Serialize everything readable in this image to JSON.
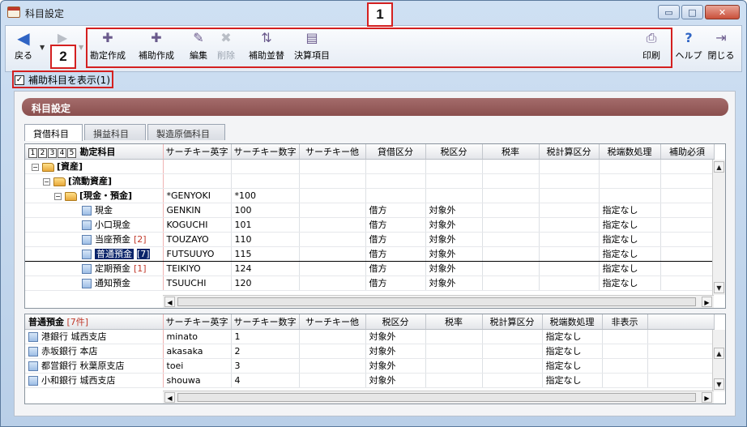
{
  "window": {
    "title": "科目設定",
    "buttons": {
      "minimize": "▭",
      "maximize": "□",
      "close": "✕"
    }
  },
  "toolbar": {
    "back": "戻る",
    "buttons": [
      {
        "id": "kanjo-sakusei",
        "label": "勘定作成",
        "icon": "add-account-icon",
        "disabled": false
      },
      {
        "id": "hojo-sakusei",
        "label": "補助作成",
        "icon": "add-sub-account-icon",
        "disabled": false
      },
      {
        "id": "henshu",
        "label": "編集",
        "icon": "edit-icon",
        "disabled": false
      },
      {
        "id": "sakujo",
        "label": "削除",
        "icon": "delete-icon",
        "disabled": true
      },
      {
        "id": "hojo-narabikae",
        "label": "補助並替",
        "icon": "reorder-icon",
        "disabled": false
      },
      {
        "id": "kessan-komoku",
        "label": "決算項目",
        "icon": "settlement-icon",
        "disabled": false
      },
      {
        "id": "insatsu",
        "label": "印刷",
        "icon": "print-icon",
        "disabled": false
      },
      {
        "id": "help",
        "label": "ヘルプ",
        "icon": "help-icon",
        "disabled": false
      },
      {
        "id": "tojiru",
        "label": "閉じる",
        "icon": "close-door-icon",
        "disabled": false
      }
    ]
  },
  "callouts": {
    "one": "1",
    "two": "2"
  },
  "show_sub": {
    "label": "補助科目を表示(1)",
    "checked": true
  },
  "panel": {
    "title": "科目設定"
  },
  "tabs": [
    {
      "label": "貸借科目",
      "active": true
    },
    {
      "label": "損益科目",
      "active": false
    },
    {
      "label": "製造原価科目",
      "active": false
    }
  ],
  "upper_grid": {
    "levels": [
      "1",
      "2",
      "3",
      "4",
      "5"
    ],
    "tree_header": "勘定科目",
    "columns": [
      "サーチキー英字",
      "サーチキー数字",
      "サーチキー他",
      "貸借区分",
      "税区分",
      "税率",
      "税計算区分",
      "税端数処理",
      "補助必須"
    ],
    "rows": [
      {
        "depth": 0,
        "type": "folder",
        "expand": "−",
        "name": "[資産]",
        "bold": true,
        "count": "",
        "cells": [
          "",
          "",
          "",
          "",
          "",
          "",
          "",
          "",
          ""
        ]
      },
      {
        "depth": 1,
        "type": "folder",
        "expand": "−",
        "name": "[流動資産]",
        "bold": true,
        "count": "",
        "cells": [
          "",
          "",
          "",
          "",
          "",
          "",
          "",
          "",
          ""
        ]
      },
      {
        "depth": 2,
        "type": "folder",
        "expand": "−",
        "name": "[現金・預金]",
        "bold": true,
        "count": "",
        "cells": [
          "*GENYOKI",
          "*100",
          "",
          "",
          "",
          "",
          "",
          "",
          ""
        ]
      },
      {
        "depth": 3,
        "type": "doc",
        "expand": "",
        "name": "現金",
        "bold": false,
        "count": "",
        "cells": [
          "GENKIN",
          "100",
          "",
          "借方",
          "対象外",
          "",
          "",
          "指定なし",
          ""
        ]
      },
      {
        "depth": 3,
        "type": "doc",
        "expand": "",
        "name": "小口現金",
        "bold": false,
        "count": "",
        "cells": [
          "KOGUCHI",
          "101",
          "",
          "借方",
          "対象外",
          "",
          "",
          "指定なし",
          ""
        ]
      },
      {
        "depth": 3,
        "type": "doc",
        "expand": "",
        "name": "当座預金",
        "bold": false,
        "count": "[2]",
        "cells": [
          "TOUZAYO",
          "110",
          "",
          "借方",
          "対象外",
          "",
          "",
          "指定なし",
          ""
        ]
      },
      {
        "depth": 3,
        "type": "doc",
        "expand": "",
        "name": "普通預金",
        "bold": false,
        "count": "[7]",
        "selected": true,
        "cells": [
          "FUTSUUYO",
          "115",
          "",
          "借方",
          "対象外",
          "",
          "",
          "指定なし",
          ""
        ]
      },
      {
        "depth": 3,
        "type": "doc",
        "expand": "",
        "name": "定期預金",
        "bold": false,
        "count": "[1]",
        "cells": [
          "TEIKIYO",
          "124",
          "",
          "借方",
          "対象外",
          "",
          "",
          "指定なし",
          ""
        ]
      },
      {
        "depth": 3,
        "type": "doc",
        "expand": "",
        "name": "通知預金",
        "bold": false,
        "count": "",
        "cells": [
          "TSUUCHI",
          "120",
          "",
          "借方",
          "対象外",
          "",
          "",
          "指定なし",
          ""
        ]
      }
    ]
  },
  "lower_grid": {
    "tree_header": "普通預金",
    "tree_header_count": "[7件]",
    "columns": [
      "サーチキー英字",
      "サーチキー数字",
      "サーチキー他",
      "税区分",
      "税率",
      "税計算区分",
      "税端数処理",
      "非表示"
    ],
    "rows": [
      {
        "name": "港銀行 城西支店",
        "cells": [
          "minato",
          "1",
          "",
          "対象外",
          "",
          "",
          "指定なし",
          ""
        ]
      },
      {
        "name": "赤坂銀行 本店",
        "cells": [
          "akasaka",
          "2",
          "",
          "対象外",
          "",
          "",
          "指定なし",
          ""
        ]
      },
      {
        "name": "都営銀行 秋葉原支店",
        "cells": [
          "toei",
          "3",
          "",
          "対象外",
          "",
          "",
          "指定なし",
          ""
        ]
      },
      {
        "name": "小和銀行 城西支店",
        "cells": [
          "shouwa",
          "4",
          "",
          "対象外",
          "",
          "",
          "指定なし",
          ""
        ]
      }
    ]
  }
}
